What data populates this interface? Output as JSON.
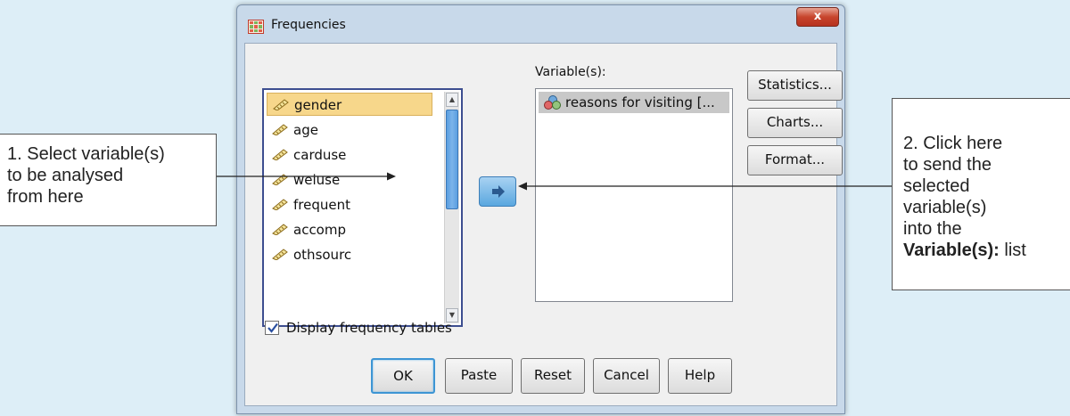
{
  "callouts": {
    "left": [
      "1. Select variable(s)",
      "to be analysed",
      "from here"
    ],
    "right_lines": [
      "2. Click here",
      "to send the",
      "selected",
      "variable(s)",
      "into the"
    ],
    "right_bold": "Variable(s):",
    "right_tail": " list"
  },
  "dialog": {
    "title": "Frequencies",
    "close_glyph": "x",
    "source_variables": [
      "gender",
      "age",
      "carduse",
      "weiuse",
      "frequent",
      "accomp",
      "othsourc"
    ],
    "selected_source": "gender",
    "target_label": "Variable(s):",
    "target_variables": [
      "reasons for visiting [..."
    ],
    "side_buttons": [
      "Statistics...",
      "Charts...",
      "Format..."
    ],
    "checkbox": {
      "label": "Display frequency tables",
      "checked": true
    },
    "bottom_buttons": [
      "OK",
      "Paste",
      "Reset",
      "Cancel",
      "Help"
    ],
    "icons": {
      "window": "table-grid-icon",
      "variable": "ruler-scale-icon",
      "target_variable": "nominal-measure-icon",
      "move": "arrow-right-icon"
    },
    "colors": {
      "selection": "#f7d78b",
      "accent": "#3d95d4",
      "close": "#c7452d"
    }
  }
}
